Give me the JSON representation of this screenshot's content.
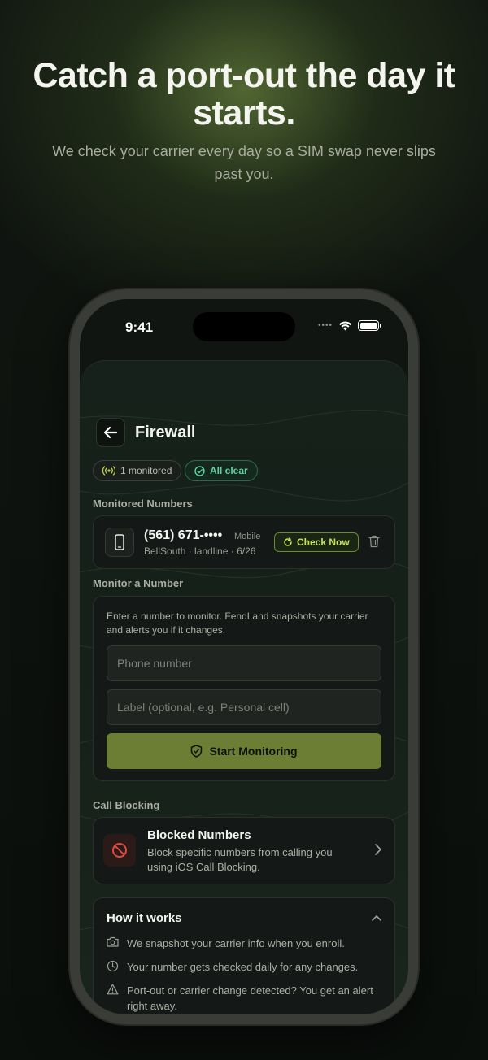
{
  "hero": {
    "title": "Catch a port-out the day it starts.",
    "subtitle": "We check your carrier every day so a SIM swap never slips past you."
  },
  "status_bar": {
    "time": "9:41",
    "signal": "••••"
  },
  "header": {
    "title": "Firewall"
  },
  "chips": {
    "monitored": "1 monitored",
    "status": "All clear"
  },
  "monitored_section": {
    "label": "Monitored Numbers",
    "numbers": [
      {
        "number": "(561) 671-••••",
        "type": "Mobile",
        "meta": "BellSouth · landline  ·  6/26",
        "action": "Check Now"
      }
    ]
  },
  "monitor_form": {
    "label": "Monitor a Number",
    "description": "Enter a number to monitor. FendLand snapshots your carrier and alerts you if it changes.",
    "phone_placeholder": "Phone number",
    "label_placeholder": "Label (optional, e.g. Personal cell)",
    "submit": "Start Monitoring"
  },
  "call_blocking": {
    "label": "Call Blocking",
    "title": "Blocked Numbers",
    "description": "Block specific numbers from calling you using iOS Call Blocking."
  },
  "how_it_works": {
    "title": "How it works",
    "items": [
      {
        "icon": "camera-icon",
        "text": "We snapshot your carrier info when you enroll."
      },
      {
        "icon": "clock-icon",
        "text": "Your number gets checked daily for any changes."
      },
      {
        "icon": "warning-icon",
        "text": "Port-out or carrier change detected? You get an alert right away."
      }
    ]
  },
  "colors": {
    "accent": "#6b7e34",
    "success": "#5fd29b",
    "check": "#c2e35a",
    "danger": "#e0493f"
  }
}
